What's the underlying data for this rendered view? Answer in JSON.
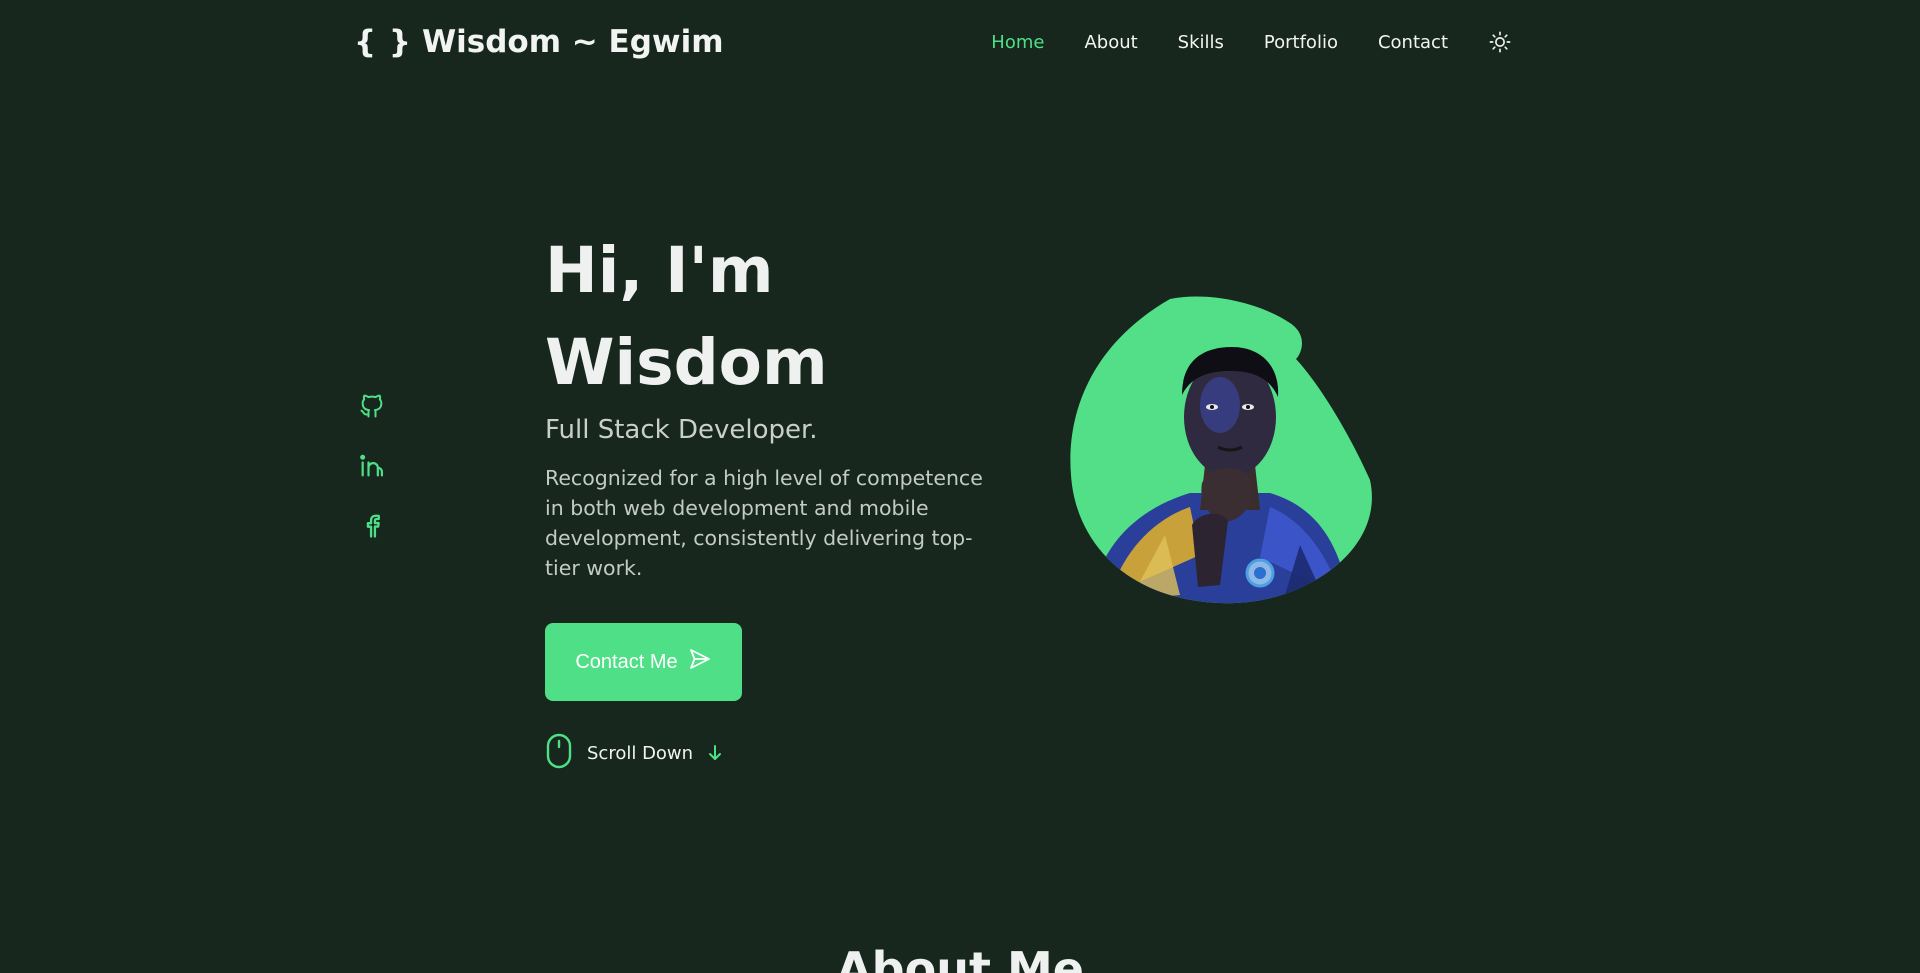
{
  "header": {
    "logo_braces": "{ }",
    "logo_text": "Wisdom ~ Egwim",
    "nav": [
      {
        "label": "Home",
        "active": true
      },
      {
        "label": "About",
        "active": false
      },
      {
        "label": "Skills",
        "active": false
      },
      {
        "label": "Portfolio",
        "active": false
      },
      {
        "label": "Contact",
        "active": false
      }
    ],
    "theme_icon": "sun-icon"
  },
  "social": [
    {
      "icon": "github-icon"
    },
    {
      "icon": "linkedin-icon"
    },
    {
      "icon": "facebook-icon"
    }
  ],
  "hero": {
    "greeting_line1": "Hi, I'm",
    "greeting_line2": "Wisdom",
    "role": "Full Stack Developer.",
    "description": "Recognized for a high level of competence in both web development and mobile development, consistently delivering top-tier work.",
    "cta_label": "Contact Me",
    "cta_icon": "send-icon",
    "scroll_label": "Scroll Down",
    "scroll_icon": "mouse-icon",
    "arrow_icon": "arrow-down-icon",
    "portrait_icon": "profile-photo"
  },
  "about": {
    "title": "About Me"
  },
  "colors": {
    "background": "#17271d",
    "accent": "#4fdf86",
    "text": "#f1f4f2"
  }
}
